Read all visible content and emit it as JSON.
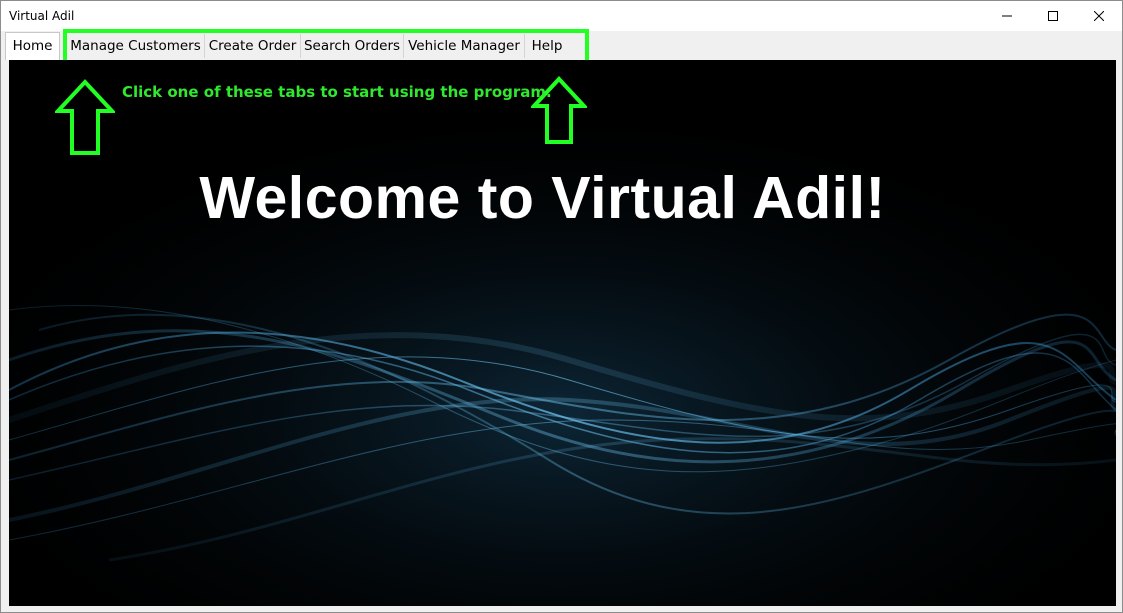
{
  "window": {
    "title": "Virtual Adil"
  },
  "tabs": [
    {
      "label": "Home",
      "selected": true
    },
    {
      "label": "Manage Customers",
      "selected": false
    },
    {
      "label": "Create Order",
      "selected": false
    },
    {
      "label": "Search Orders",
      "selected": false
    },
    {
      "label": "Vehicle Manager",
      "selected": false
    },
    {
      "label": "Help",
      "selected": false
    }
  ],
  "content": {
    "hint": "Click one of these tabs to start using the program.",
    "welcome": "Welcome to Virtual Adil!"
  },
  "icons": {
    "minimize": "minimize-icon",
    "maximize": "maximize-icon",
    "close": "close-icon",
    "arrow": "up-arrow-icon"
  },
  "colors": {
    "highlight": "#22ff22",
    "hint_text": "#2fe82f",
    "background": "#000000",
    "wave": "#3a9ad9"
  }
}
